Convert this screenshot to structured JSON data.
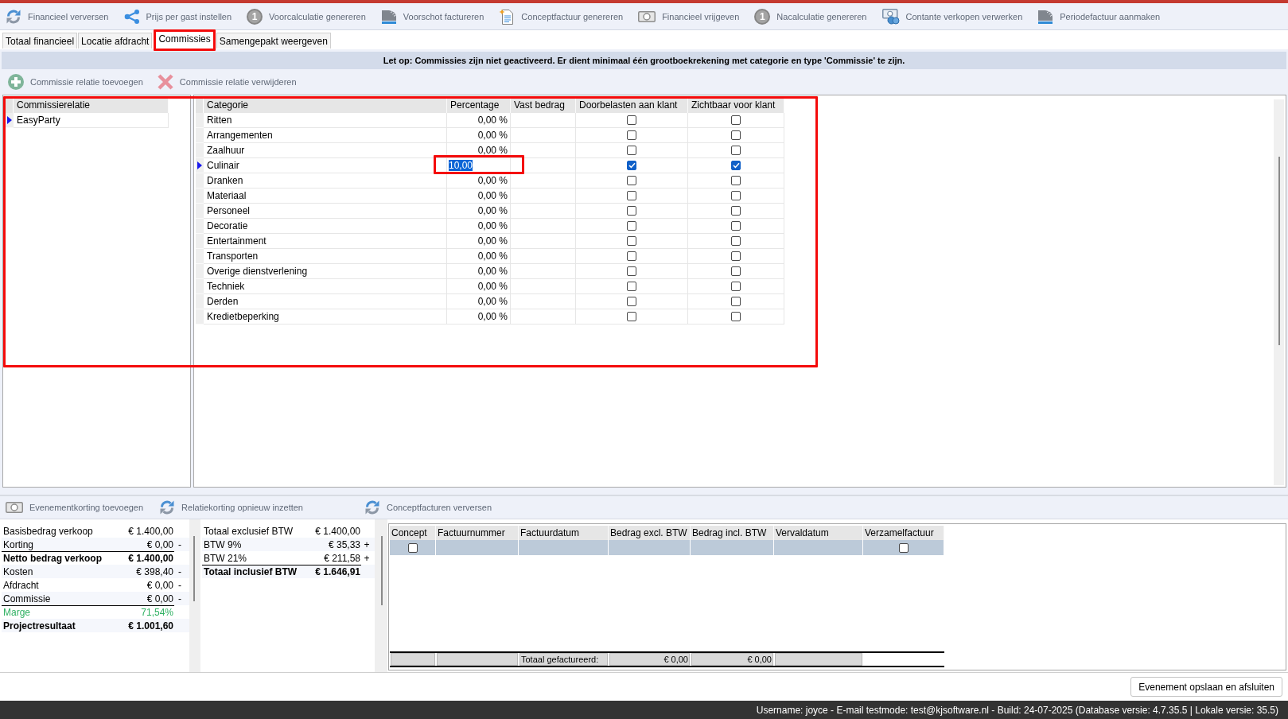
{
  "toolbar": [
    {
      "label": "Financieel verversen",
      "kind": "refresh"
    },
    {
      "label": "Prijs per gast instellen",
      "kind": "share"
    },
    {
      "label": "Voorcalculatie genereren",
      "kind": "number",
      "icon_glyph": "1"
    },
    {
      "label": "Voorschot factureren",
      "kind": "stack"
    },
    {
      "label": "Conceptfactuur genereren",
      "kind": "document"
    },
    {
      "label": "Financieel vrijgeven",
      "kind": "banknote"
    },
    {
      "label": "Nacalculatie genereren",
      "kind": "number",
      "icon_glyph": "1"
    },
    {
      "label": "Contante verkopen verwerken",
      "kind": "cash"
    },
    {
      "label": "Periodefactuur aanmaken",
      "kind": "stack"
    }
  ],
  "tabs": [
    {
      "label": "Totaal financieel",
      "selected": false,
      "highlighted": false
    },
    {
      "label": "Locatie afdracht",
      "selected": false,
      "highlighted": false
    },
    {
      "label": "Commissies",
      "selected": true,
      "highlighted": true
    },
    {
      "label": "Samengepakt weergeven",
      "selected": false,
      "highlighted": false
    }
  ],
  "notice": "Let op: Commissies zijn niet geactiveerd. Er dient minimaal één grootboekrekening met categorie en type 'Commissie' te zijn.",
  "actions": [
    {
      "label": "Commissie relatie toevoegen",
      "kind": "add"
    },
    {
      "label": "Commissie relatie verwijderen",
      "kind": "remove"
    }
  ],
  "commission_panel": {
    "highlighted": true,
    "relations": {
      "column": "Commissierelatie",
      "rows": [
        {
          "name": "EasyParty",
          "selected": true
        }
      ]
    },
    "categories": {
      "columns": [
        "Categorie",
        "Percentage",
        "Vast bedrag",
        "Doorbelasten aan klant",
        "Zichtbaar voor klant"
      ],
      "rows": [
        {
          "name": "Ritten",
          "percentage": "0,00 %",
          "charge_to_client": false,
          "visible_to_client": false,
          "selected": false,
          "editing": false,
          "highlighted": false
        },
        {
          "name": "Arrangementen",
          "percentage": "0,00 %",
          "charge_to_client": false,
          "visible_to_client": false,
          "selected": false,
          "editing": false,
          "highlighted": false
        },
        {
          "name": "Zaalhuur",
          "percentage": "0,00 %",
          "charge_to_client": false,
          "visible_to_client": false,
          "selected": false,
          "editing": false,
          "highlighted": false
        },
        {
          "name": "Culinair",
          "percentage": "10,00",
          "charge_to_client": true,
          "visible_to_client": true,
          "selected": true,
          "editing": true,
          "highlighted": true
        },
        {
          "name": "Dranken",
          "percentage": "0,00 %",
          "charge_to_client": false,
          "visible_to_client": false,
          "selected": false,
          "editing": false,
          "highlighted": false
        },
        {
          "name": "Materiaal",
          "percentage": "0,00 %",
          "charge_to_client": false,
          "visible_to_client": false,
          "selected": false,
          "editing": false,
          "highlighted": false
        },
        {
          "name": "Personeel",
          "percentage": "0,00 %",
          "charge_to_client": false,
          "visible_to_client": false,
          "selected": false,
          "editing": false,
          "highlighted": false
        },
        {
          "name": "Decoratie",
          "percentage": "0,00 %",
          "charge_to_client": false,
          "visible_to_client": false,
          "selected": false,
          "editing": false,
          "highlighted": false
        },
        {
          "name": "Entertainment",
          "percentage": "0,00 %",
          "charge_to_client": false,
          "visible_to_client": false,
          "selected": false,
          "editing": false,
          "highlighted": false
        },
        {
          "name": "Transporten",
          "percentage": "0,00 %",
          "charge_to_client": false,
          "visible_to_client": false,
          "selected": false,
          "editing": false,
          "highlighted": false
        },
        {
          "name": "Overige dienstverlening",
          "percentage": "0,00 %",
          "charge_to_client": false,
          "visible_to_client": false,
          "selected": false,
          "editing": false,
          "highlighted": false
        },
        {
          "name": "Techniek",
          "percentage": "0,00 %",
          "charge_to_client": false,
          "visible_to_client": false,
          "selected": false,
          "editing": false,
          "highlighted": false
        },
        {
          "name": "Derden",
          "percentage": "0,00 %",
          "charge_to_client": false,
          "visible_to_client": false,
          "selected": false,
          "editing": false,
          "highlighted": false
        },
        {
          "name": "Kredietbeperking",
          "percentage": "0,00 %",
          "charge_to_client": false,
          "visible_to_client": false,
          "selected": false,
          "editing": false,
          "highlighted": false
        }
      ]
    }
  },
  "summary_actions": [
    {
      "label": "Evenementkorting toevoegen",
      "kind": "banknote"
    },
    {
      "label": "Relatiekorting opnieuw inzetten",
      "kind": "refresh"
    }
  ],
  "invoice_actions": [
    {
      "label": "Conceptfacturen verversen",
      "kind": "refresh"
    }
  ],
  "summary": [
    {
      "label": "Basisbedrag verkoop",
      "value": "€ 1.400,00",
      "kind": "plain",
      "rule_above": false
    },
    {
      "label": "Korting",
      "value": "€ 0,00",
      "sign": "-",
      "kind": "plain",
      "rule_above": false
    },
    {
      "label": "Netto bedrag verkoop",
      "value": "€ 1.400,00",
      "kind": "total",
      "rule_above": true
    },
    {
      "label": "Kosten",
      "value": "€ 398,40",
      "sign": "-",
      "kind": "plain",
      "rule_above": false
    },
    {
      "label": "Afdracht",
      "value": "€ 0,00",
      "sign": "-",
      "kind": "plain",
      "rule_above": false
    },
    {
      "label": "Commissie",
      "value": "€ 0,00",
      "sign": "-",
      "kind": "plain",
      "rule_above": false
    },
    {
      "label": "Marge",
      "value": "71,54%",
      "kind": "margin",
      "rule_above": true
    },
    {
      "label": "Projectresultaat",
      "value": "€ 1.001,60",
      "kind": "total",
      "rule_above": false
    }
  ],
  "vat_summary": [
    {
      "label": "Totaal exclusief BTW",
      "value": "€ 1.400,00",
      "kind": "plain",
      "rule_above": false
    },
    {
      "label": "BTW 9%",
      "value": "€ 35,33",
      "sign": "+",
      "kind": "plain",
      "rule_above": false
    },
    {
      "label": "BTW 21%",
      "value": "€ 211,58",
      "sign": "+",
      "kind": "plain",
      "rule_above": false
    },
    {
      "label": "Totaal inclusief BTW",
      "value": "€ 1.646,91",
      "kind": "total",
      "rule_above": true
    }
  ],
  "invoices": {
    "columns": [
      "Concept",
      "Factuurnummer",
      "Factuurdatum",
      "Bedrag excl. BTW",
      "Bedrag incl. BTW",
      "Vervaldatum",
      "Verzamelfactuur"
    ],
    "rows": [
      {
        "concept": false,
        "collective": false,
        "selected": true
      }
    ],
    "footer": {
      "label": "Totaal gefactureerd:",
      "total_excl": "€ 0,00",
      "total_incl": "€ 0,00"
    }
  },
  "save_button": "Evenement opslaan en afsluiten",
  "status_bar": "Username: joyce - E-mail testmode: test@kjsoftware.nl - Build: 24-07-2025 (Database versie: 4.7.35.5 | Lokale versie: 35.5)"
}
